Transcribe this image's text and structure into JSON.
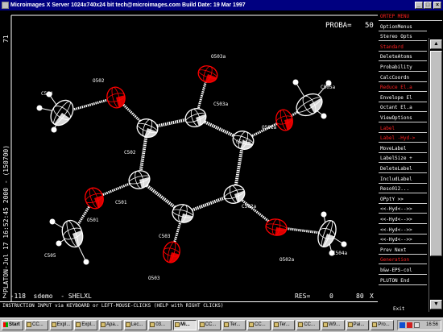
{
  "window": {
    "title": "Microimages X Server  1024x740x24 bit  tech@microimages.com  Build Date: 19 Mar 1997",
    "min_label": "_",
    "max_label": "□",
    "close_label": "×"
  },
  "canvas": {
    "proba_label": "PROBA=",
    "proba_value": "50",
    "side_text": "PLATON-Jul 17 16:52:45 2000 - (150700)",
    "side_num": "71",
    "bottom_left": "Z -118  sdemo  - SHELXL",
    "res_label": "RES=",
    "res_value": "0",
    "pct_value": "80",
    "pct_unit": "X",
    "atom_labels": [
      "O503a",
      "O502",
      "C504",
      "C503a",
      "O501a",
      "C505a",
      "C502",
      "C501a",
      "C501",
      "C502a",
      "O501",
      "C503",
      "C505",
      "O503",
      "O502a",
      "C504a"
    ]
  },
  "menu": {
    "items": [
      {
        "label": "ORTEP  MENU",
        "red": true,
        "header": true
      },
      {
        "label": "OptionMenus",
        "red": false
      },
      {
        "label": "Stereo Opts",
        "red": false
      },
      {
        "label": "Standard",
        "red": true
      },
      {
        "label": "DeleteAtoms",
        "red": false
      },
      {
        "label": "Probability",
        "red": false
      },
      {
        "label": "CalcCoordn",
        "red": false
      },
      {
        "label": "Reduce El.a",
        "red": true
      },
      {
        "label": "Envelope El",
        "red": false
      },
      {
        "label": "Octant El.a",
        "red": false
      },
      {
        "label": "ViewOptions",
        "red": false
      },
      {
        "label": "Label",
        "red": true
      },
      {
        "label": "Label -Hyd->",
        "red": true
      },
      {
        "label": "MoveLabel",
        "red": false
      },
      {
        "label": "LabelSize +",
        "red": false
      },
      {
        "label": "DeleteLabel",
        "red": false
      },
      {
        "label": "IncludLabel",
        "red": false
      },
      {
        "label": "Reso012...",
        "red": false
      },
      {
        "label": "OPptY >>",
        "red": false
      },
      {
        "label": "<<-Hyd<-->>",
        "red": false
      },
      {
        "label": "<<-Hyd<-->>",
        "red": false
      },
      {
        "label": "<<-Hyd<-->>",
        "red": false
      },
      {
        "label": "<<-Hyd<-->>",
        "red": false
      },
      {
        "label": "Prev   Next",
        "red": false
      },
      {
        "label": "Generation",
        "red": true
      },
      {
        "label": "b&w-EPS-col",
        "red": false
      },
      {
        "label": "PLUTON  End",
        "red": false
      },
      {
        "label": "Exit",
        "red": false
      }
    ]
  },
  "status": {
    "text": "INSTRUCTION INPUT via KEYBOARD or LEFT-MOUSE-CLICKS (HELP with RIGHT CLICKS)"
  },
  "taskbar": {
    "start_label": "Start",
    "buttons": [
      {
        "label": "CC..."
      },
      {
        "label": "Expl..."
      },
      {
        "label": "Expl..."
      },
      {
        "label": "Apa..."
      },
      {
        "label": "Lec..."
      },
      {
        "label": "03..."
      },
      {
        "label": "Mi...",
        "active": true
      },
      {
        "label": "CC..."
      },
      {
        "label": "Ter..."
      },
      {
        "label": "CC..."
      },
      {
        "label": "Ter..."
      },
      {
        "label": "CC..."
      },
      {
        "label": "W9..."
      },
      {
        "label": "Pai..."
      },
      {
        "label": "Pro..."
      }
    ],
    "clock": "16:56"
  },
  "colors": {
    "title_bg": "#000080",
    "thermal_red": "#ff0000",
    "menu_red": "#ff2020"
  }
}
